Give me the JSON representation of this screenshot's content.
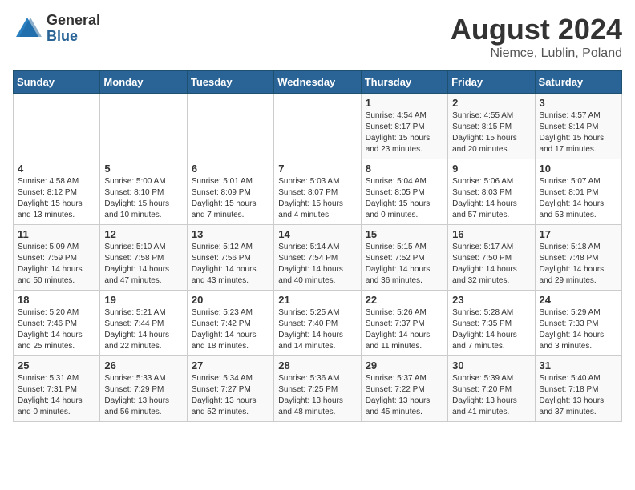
{
  "header": {
    "logo_general": "General",
    "logo_blue": "Blue",
    "title": "August 2024",
    "subtitle": "Niemce, Lublin, Poland"
  },
  "days_of_week": [
    "Sunday",
    "Monday",
    "Tuesday",
    "Wednesday",
    "Thursday",
    "Friday",
    "Saturday"
  ],
  "weeks": [
    [
      {
        "day": "",
        "info": ""
      },
      {
        "day": "",
        "info": ""
      },
      {
        "day": "",
        "info": ""
      },
      {
        "day": "",
        "info": ""
      },
      {
        "day": "1",
        "info": "Sunrise: 4:54 AM\nSunset: 8:17 PM\nDaylight: 15 hours\nand 23 minutes."
      },
      {
        "day": "2",
        "info": "Sunrise: 4:55 AM\nSunset: 8:15 PM\nDaylight: 15 hours\nand 20 minutes."
      },
      {
        "day": "3",
        "info": "Sunrise: 4:57 AM\nSunset: 8:14 PM\nDaylight: 15 hours\nand 17 minutes."
      }
    ],
    [
      {
        "day": "4",
        "info": "Sunrise: 4:58 AM\nSunset: 8:12 PM\nDaylight: 15 hours\nand 13 minutes."
      },
      {
        "day": "5",
        "info": "Sunrise: 5:00 AM\nSunset: 8:10 PM\nDaylight: 15 hours\nand 10 minutes."
      },
      {
        "day": "6",
        "info": "Sunrise: 5:01 AM\nSunset: 8:09 PM\nDaylight: 15 hours\nand 7 minutes."
      },
      {
        "day": "7",
        "info": "Sunrise: 5:03 AM\nSunset: 8:07 PM\nDaylight: 15 hours\nand 4 minutes."
      },
      {
        "day": "8",
        "info": "Sunrise: 5:04 AM\nSunset: 8:05 PM\nDaylight: 15 hours\nand 0 minutes."
      },
      {
        "day": "9",
        "info": "Sunrise: 5:06 AM\nSunset: 8:03 PM\nDaylight: 14 hours\nand 57 minutes."
      },
      {
        "day": "10",
        "info": "Sunrise: 5:07 AM\nSunset: 8:01 PM\nDaylight: 14 hours\nand 53 minutes."
      }
    ],
    [
      {
        "day": "11",
        "info": "Sunrise: 5:09 AM\nSunset: 7:59 PM\nDaylight: 14 hours\nand 50 minutes."
      },
      {
        "day": "12",
        "info": "Sunrise: 5:10 AM\nSunset: 7:58 PM\nDaylight: 14 hours\nand 47 minutes."
      },
      {
        "day": "13",
        "info": "Sunrise: 5:12 AM\nSunset: 7:56 PM\nDaylight: 14 hours\nand 43 minutes."
      },
      {
        "day": "14",
        "info": "Sunrise: 5:14 AM\nSunset: 7:54 PM\nDaylight: 14 hours\nand 40 minutes."
      },
      {
        "day": "15",
        "info": "Sunrise: 5:15 AM\nSunset: 7:52 PM\nDaylight: 14 hours\nand 36 minutes."
      },
      {
        "day": "16",
        "info": "Sunrise: 5:17 AM\nSunset: 7:50 PM\nDaylight: 14 hours\nand 32 minutes."
      },
      {
        "day": "17",
        "info": "Sunrise: 5:18 AM\nSunset: 7:48 PM\nDaylight: 14 hours\nand 29 minutes."
      }
    ],
    [
      {
        "day": "18",
        "info": "Sunrise: 5:20 AM\nSunset: 7:46 PM\nDaylight: 14 hours\nand 25 minutes."
      },
      {
        "day": "19",
        "info": "Sunrise: 5:21 AM\nSunset: 7:44 PM\nDaylight: 14 hours\nand 22 minutes."
      },
      {
        "day": "20",
        "info": "Sunrise: 5:23 AM\nSunset: 7:42 PM\nDaylight: 14 hours\nand 18 minutes."
      },
      {
        "day": "21",
        "info": "Sunrise: 5:25 AM\nSunset: 7:40 PM\nDaylight: 14 hours\nand 14 minutes."
      },
      {
        "day": "22",
        "info": "Sunrise: 5:26 AM\nSunset: 7:37 PM\nDaylight: 14 hours\nand 11 minutes."
      },
      {
        "day": "23",
        "info": "Sunrise: 5:28 AM\nSunset: 7:35 PM\nDaylight: 14 hours\nand 7 minutes."
      },
      {
        "day": "24",
        "info": "Sunrise: 5:29 AM\nSunset: 7:33 PM\nDaylight: 14 hours\nand 3 minutes."
      }
    ],
    [
      {
        "day": "25",
        "info": "Sunrise: 5:31 AM\nSunset: 7:31 PM\nDaylight: 14 hours\nand 0 minutes."
      },
      {
        "day": "26",
        "info": "Sunrise: 5:33 AM\nSunset: 7:29 PM\nDaylight: 13 hours\nand 56 minutes."
      },
      {
        "day": "27",
        "info": "Sunrise: 5:34 AM\nSunset: 7:27 PM\nDaylight: 13 hours\nand 52 minutes."
      },
      {
        "day": "28",
        "info": "Sunrise: 5:36 AM\nSunset: 7:25 PM\nDaylight: 13 hours\nand 48 minutes."
      },
      {
        "day": "29",
        "info": "Sunrise: 5:37 AM\nSunset: 7:22 PM\nDaylight: 13 hours\nand 45 minutes."
      },
      {
        "day": "30",
        "info": "Sunrise: 5:39 AM\nSunset: 7:20 PM\nDaylight: 13 hours\nand 41 minutes."
      },
      {
        "day": "31",
        "info": "Sunrise: 5:40 AM\nSunset: 7:18 PM\nDaylight: 13 hours\nand 37 minutes."
      }
    ]
  ]
}
